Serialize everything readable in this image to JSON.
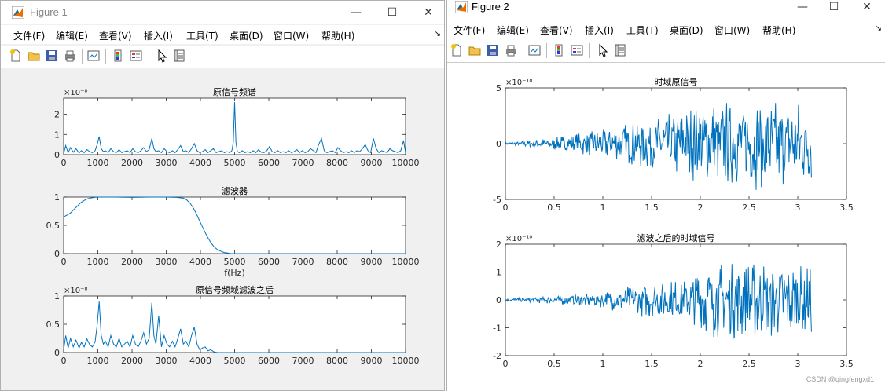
{
  "windows": [
    {
      "title": "Figure 1",
      "menu": [
        "文件(F)",
        "编辑(E)",
        "查看(V)",
        "插入(I)",
        "工具(T)",
        "桌面(D)",
        "窗口(W)",
        "帮助(H)"
      ],
      "toolbar_icons": [
        "new-file-icon",
        "open-folder-icon",
        "save-icon",
        "print-icon",
        "link-plot-icon",
        "colorbar-icon",
        "legend-icon",
        "pointer-icon",
        "property-inspector-icon"
      ]
    },
    {
      "title": "Figure 2",
      "menu": [
        "文件(F)",
        "编辑(E)",
        "查看(V)",
        "插入(I)",
        "工具(T)",
        "桌面(D)",
        "窗口(W)",
        "帮助(H)"
      ],
      "toolbar_icons": [
        "new-file-icon",
        "open-folder-icon",
        "save-icon",
        "print-icon",
        "link-plot-icon",
        "colorbar-icon",
        "legend-icon",
        "pointer-icon",
        "property-inspector-icon"
      ]
    }
  ],
  "colors": {
    "line": "#0072BD",
    "figure_bg": "#f0f0f0",
    "axes_bg": "#ffffff"
  },
  "chart_data": [
    {
      "type": "line",
      "title": "原信号频谱",
      "xlabel": "",
      "ylabel": "",
      "exponent": "×10⁻⁸",
      "xlim": [
        0,
        10000
      ],
      "ylim": [
        0,
        2.8
      ],
      "xticks": [
        0,
        1000,
        2000,
        3000,
        4000,
        5000,
        6000,
        7000,
        8000,
        9000,
        10000
      ],
      "yticks": [
        0,
        1,
        2
      ],
      "series": [
        {
          "x": [
            0,
            60,
            130,
            200,
            280,
            360,
            450,
            520,
            600,
            680,
            760,
            840,
            920,
            980,
            1040,
            1100,
            1160,
            1220,
            1300,
            1380,
            1460,
            1540,
            1620,
            1700,
            1780,
            1860,
            1940,
            2020,
            2100,
            2180,
            2260,
            2340,
            2420,
            2500,
            2580,
            2640,
            2700,
            2780,
            2860,
            2940,
            3020,
            3100,
            3180,
            3260,
            3340,
            3420,
            3500,
            3580,
            3660,
            3740,
            3820,
            3900,
            3980,
            4060,
            4140,
            4220,
            4300,
            4380,
            4460,
            4540,
            4620,
            4700,
            4780,
            4860,
            4920,
            4960,
            5000,
            5040,
            5080,
            5140,
            5220,
            5300,
            5380,
            5460,
            5540,
            5620,
            5700,
            5780,
            5860,
            5940,
            6020,
            6100,
            6180,
            6260,
            6340,
            6420,
            6500,
            6580,
            6660,
            6740,
            6820,
            6900,
            6980,
            7060,
            7140,
            7220,
            7300,
            7380,
            7460,
            7540,
            7620,
            7700,
            7780,
            7860,
            7940,
            8020,
            8100,
            8180,
            8260,
            8340,
            8420,
            8500,
            8580,
            8660,
            8740,
            8820,
            8900,
            8980,
            9060,
            9140,
            9220,
            9300,
            9380,
            9460,
            9540,
            9620,
            9700,
            9780,
            9860,
            9940,
            10000
          ],
          "y": [
            0.05,
            0.45,
            0.1,
            0.35,
            0.12,
            0.3,
            0.08,
            0.2,
            0.1,
            0.25,
            0.15,
            0.1,
            0.2,
            0.5,
            0.9,
            0.3,
            0.15,
            0.2,
            0.1,
            0.3,
            0.15,
            0.1,
            0.25,
            0.1,
            0.15,
            0.2,
            0.1,
            0.3,
            0.15,
            0.1,
            0.2,
            0.35,
            0.15,
            0.25,
            0.8,
            0.3,
            0.15,
            0.2,
            0.1,
            0.3,
            0.15,
            0.1,
            0.2,
            0.1,
            0.25,
            0.45,
            0.15,
            0.2,
            0.1,
            0.3,
            0.55,
            0.2,
            0.1,
            0.15,
            0.25,
            0.1,
            0.2,
            0.3,
            0.1,
            0.15,
            0.2,
            0.1,
            0.15,
            0.1,
            0.2,
            0.6,
            2.6,
            0.6,
            0.15,
            0.1,
            0.2,
            0.1,
            0.15,
            0.1,
            0.2,
            0.1,
            0.25,
            0.12,
            0.1,
            0.2,
            0.4,
            0.15,
            0.1,
            0.2,
            0.1,
            0.15,
            0.1,
            0.2,
            0.1,
            0.15,
            0.25,
            0.1,
            0.2,
            0.1,
            0.15,
            0.3,
            0.2,
            0.1,
            0.5,
            0.8,
            0.2,
            0.1,
            0.15,
            0.2,
            0.1,
            0.35,
            0.2,
            0.1,
            0.15,
            0.1,
            0.2,
            0.1,
            0.2,
            0.15,
            0.3,
            0.5,
            0.2,
            0.1,
            0.8,
            0.3,
            0.1,
            0.2,
            0.15,
            0.1,
            0.3,
            0.2,
            0.15,
            0.1,
            0.2,
            0.7,
            0.1
          ]
        }
      ]
    },
    {
      "type": "line",
      "title": "滤波器",
      "xlabel": "f(Hz)",
      "ylabel": "",
      "exponent": "",
      "xlim": [
        0,
        10000
      ],
      "ylim": [
        0,
        1
      ],
      "xticks": [
        0,
        1000,
        2000,
        3000,
        4000,
        5000,
        6000,
        7000,
        8000,
        9000,
        10000
      ],
      "yticks": [
        0,
        0.5,
        1
      ],
      "series": [
        {
          "x": [
            0,
            100,
            200,
            300,
            400,
            500,
            600,
            700,
            800,
            900,
            1000,
            1200,
            1500,
            2000,
            2500,
            3000,
            3300,
            3500,
            3600,
            3700,
            3800,
            3900,
            4000,
            4100,
            4200,
            4300,
            4400,
            4500,
            4600,
            4700,
            4800,
            4900,
            5000,
            6000,
            8000,
            10000
          ],
          "y": [
            0.65,
            0.68,
            0.72,
            0.78,
            0.84,
            0.9,
            0.94,
            0.97,
            0.985,
            0.995,
            1.0,
            1.0,
            1.0,
            0.995,
            1.0,
            1.0,
            0.995,
            0.98,
            0.95,
            0.89,
            0.8,
            0.68,
            0.55,
            0.42,
            0.3,
            0.2,
            0.12,
            0.07,
            0.04,
            0.02,
            0.01,
            0.0,
            0.0,
            0.0,
            0.0,
            0.0
          ]
        }
      ]
    },
    {
      "type": "line",
      "title": "原信号频域滤波之后",
      "xlabel": "",
      "ylabel": "",
      "exponent": "×10⁻⁸",
      "xlim": [
        0,
        10000
      ],
      "ylim": [
        0,
        1
      ],
      "xticks": [
        0,
        1000,
        2000,
        3000,
        4000,
        5000,
        6000,
        7000,
        8000,
        9000,
        10000
      ],
      "yticks": [
        0,
        0.5,
        1
      ],
      "series": [
        {
          "x": [
            0,
            60,
            130,
            200,
            280,
            360,
            450,
            520,
            600,
            680,
            760,
            840,
            920,
            980,
            1040,
            1100,
            1160,
            1220,
            1300,
            1380,
            1460,
            1540,
            1620,
            1700,
            1780,
            1860,
            1940,
            2020,
            2100,
            2180,
            2260,
            2340,
            2420,
            2500,
            2580,
            2640,
            2700,
            2780,
            2860,
            2940,
            3020,
            3100,
            3180,
            3260,
            3340,
            3420,
            3500,
            3580,
            3660,
            3740,
            3820,
            3900,
            3980,
            4060,
            4140,
            4220,
            4300,
            4400,
            4500,
            5000,
            6000,
            7000,
            8000,
            9000,
            10000
          ],
          "y": [
            0.05,
            0.3,
            0.08,
            0.25,
            0.1,
            0.22,
            0.08,
            0.18,
            0.1,
            0.24,
            0.14,
            0.1,
            0.19,
            0.48,
            0.9,
            0.3,
            0.15,
            0.2,
            0.1,
            0.3,
            0.15,
            0.1,
            0.25,
            0.1,
            0.15,
            0.2,
            0.1,
            0.3,
            0.15,
            0.1,
            0.2,
            0.35,
            0.15,
            0.25,
            0.88,
            0.3,
            0.15,
            0.65,
            0.1,
            0.3,
            0.15,
            0.1,
            0.2,
            0.1,
            0.25,
            0.42,
            0.15,
            0.2,
            0.1,
            0.3,
            0.45,
            0.15,
            0.05,
            0.08,
            0.1,
            0.03,
            0.05,
            0.01,
            0.0,
            0.0,
            0.0,
            0.0,
            0.0,
            0.0,
            0.0
          ]
        }
      ]
    },
    {
      "type": "line",
      "title": "时域原信号",
      "xlabel": "",
      "ylabel": "",
      "exponent": "×10⁻¹⁰",
      "xlim": [
        0,
        3.5
      ],
      "ylim": [
        -5,
        5
      ],
      "xticks": [
        0,
        0.5,
        1,
        1.5,
        2,
        2.5,
        3,
        3.5
      ],
      "yticks": [
        -5,
        0,
        5
      ],
      "series": [
        {
          "amp_envelope": [
            [
              0,
              0.1
            ],
            [
              0.5,
              0.6
            ],
            [
              1.0,
              1.4
            ],
            [
              1.5,
              2.5
            ],
            [
              2.0,
              3.8
            ],
            [
              2.5,
              4.2
            ],
            [
              3.14,
              3.9
            ]
          ],
          "x_end": 3.14
        }
      ]
    },
    {
      "type": "line",
      "title": "滤波之后的时域信号",
      "xlabel": "",
      "ylabel": "",
      "exponent": "×10⁻¹⁰",
      "xlim": [
        0,
        3.5
      ],
      "ylim": [
        -2,
        2
      ],
      "xticks": [
        0,
        0.5,
        1,
        1.5,
        2,
        2.5,
        3,
        3.5
      ],
      "yticks": [
        -2,
        -1,
        0,
        1,
        2
      ],
      "series": [
        {
          "amp_envelope": [
            [
              0,
              0.05
            ],
            [
              0.5,
              0.15
            ],
            [
              1.0,
              0.3
            ],
            [
              1.5,
              0.7
            ],
            [
              1.9,
              0.8
            ],
            [
              2.0,
              1.4
            ],
            [
              2.5,
              1.5
            ],
            [
              3.14,
              1.3
            ]
          ],
          "x_end": 3.14
        }
      ]
    }
  ],
  "watermark": "CSDN @qingfengxd1"
}
